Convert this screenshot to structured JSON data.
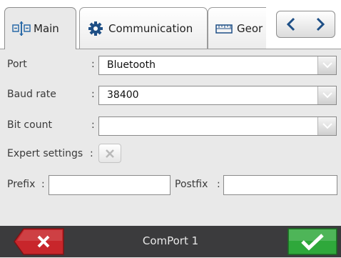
{
  "tabs": [
    {
      "label": "Main",
      "icon": "main-settings-icon",
      "active": true
    },
    {
      "label": "Communication",
      "icon": "gear-icon",
      "active": false
    },
    {
      "label": "Geor",
      "icon": "ruler-icon",
      "active": false
    }
  ],
  "nav": {
    "prev_icon": "chevron-left-icon",
    "next_icon": "chevron-right-icon"
  },
  "fields": {
    "port": {
      "label": "Port",
      "colon": ":",
      "value": "Bluetooth"
    },
    "baud_rate": {
      "label": "Baud rate",
      "colon": ":",
      "value": "38400"
    },
    "bit_count": {
      "label": "Bit count",
      "colon": ":",
      "value": ""
    },
    "expert_settings": {
      "label": "Expert settings",
      "colon": ":",
      "checked": false
    },
    "prefix": {
      "label": "Prefix",
      "colon": ":",
      "value": ""
    },
    "postfix": {
      "label": "Postfix",
      "colon": ":",
      "value": ""
    }
  },
  "bottom": {
    "title": "ComPort 1",
    "cancel_icon": "x-icon",
    "ok_icon": "checkmark-icon"
  },
  "colors": {
    "cancel": "#c8262b",
    "ok": "#2fa83b",
    "bar": "#3b3b3d"
  }
}
